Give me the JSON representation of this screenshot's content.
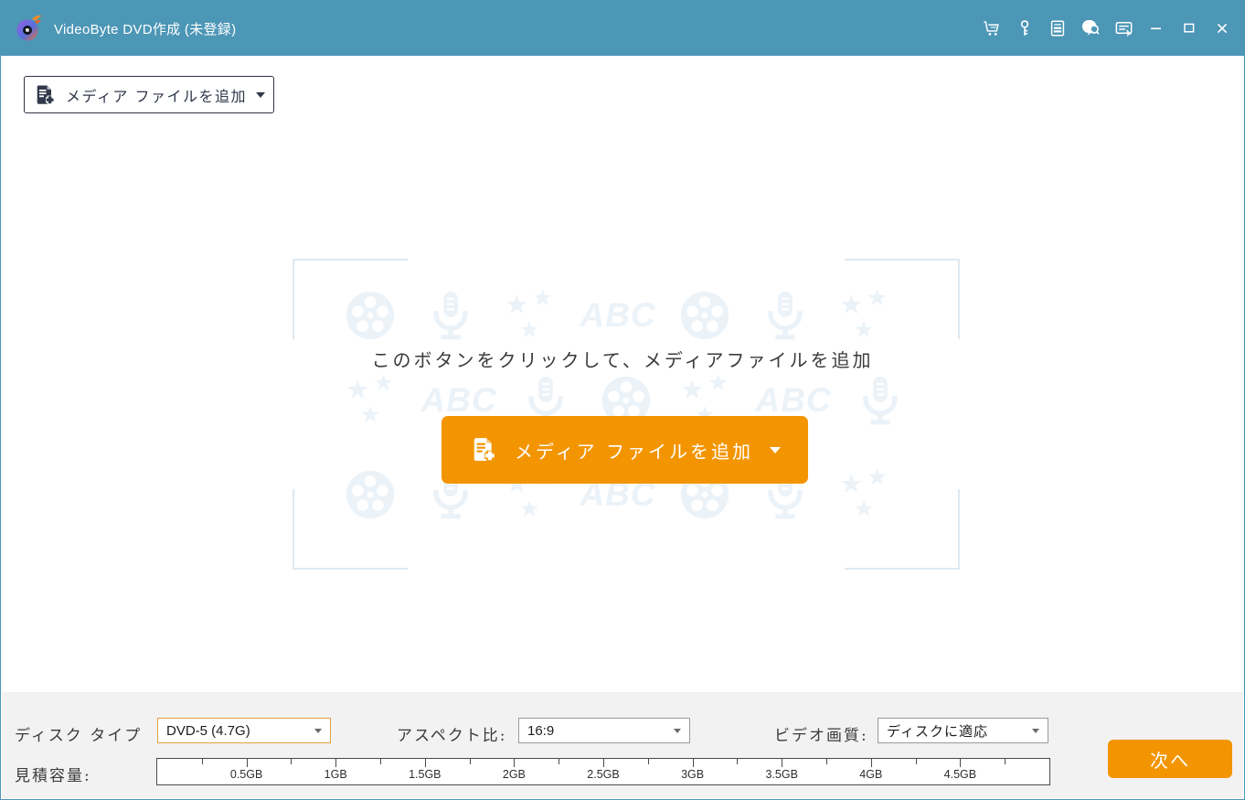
{
  "colors": {
    "titlebar_bg": "#4C96B6",
    "accent_orange": "#F39500",
    "bottombar_bg": "#F2F2F2",
    "watermark": "#EBF2F8"
  },
  "titlebar": {
    "title": "VideoByte DVD作成 (未登録)",
    "icon_names": [
      "cart-icon",
      "key-icon",
      "license-icon",
      "feedback-icon",
      "menu-icon"
    ],
    "window_controls": [
      "minimize",
      "maximize",
      "close"
    ]
  },
  "toolbar": {
    "add_media_label": "メディア ファイルを追加"
  },
  "dropzone": {
    "hint": "このボタンをクリックして、メディアファイルを追加",
    "add_button_label": "メディア ファイルを追加",
    "watermark_abc_text": "ABC",
    "watermark_rows": [
      [
        "film",
        "mic",
        "stars",
        "abc",
        "film",
        "mic",
        "stars"
      ],
      [
        "stars",
        "abc",
        "mic",
        "film",
        "stars",
        "abc",
        "mic"
      ],
      [
        "film",
        "mic",
        "stars",
        "abc",
        "film",
        "mic",
        "stars"
      ]
    ]
  },
  "settings": {
    "disc_type_label": "ディスク タイプ",
    "disc_type_value": "DVD-5 (4.7G)",
    "aspect_ratio_label": "アスペクト比:",
    "aspect_ratio_value": "16:9",
    "video_quality_label": "ビデオ画質:",
    "video_quality_value": "ディスクに適応"
  },
  "capacity": {
    "label": "見積容量:",
    "tick_labels": [
      "0.5GB",
      "1GB",
      "1.5GB",
      "2GB",
      "2.5GB",
      "3GB",
      "3.5GB",
      "4GB",
      "4.5GB"
    ]
  },
  "next_button_label": "次へ"
}
